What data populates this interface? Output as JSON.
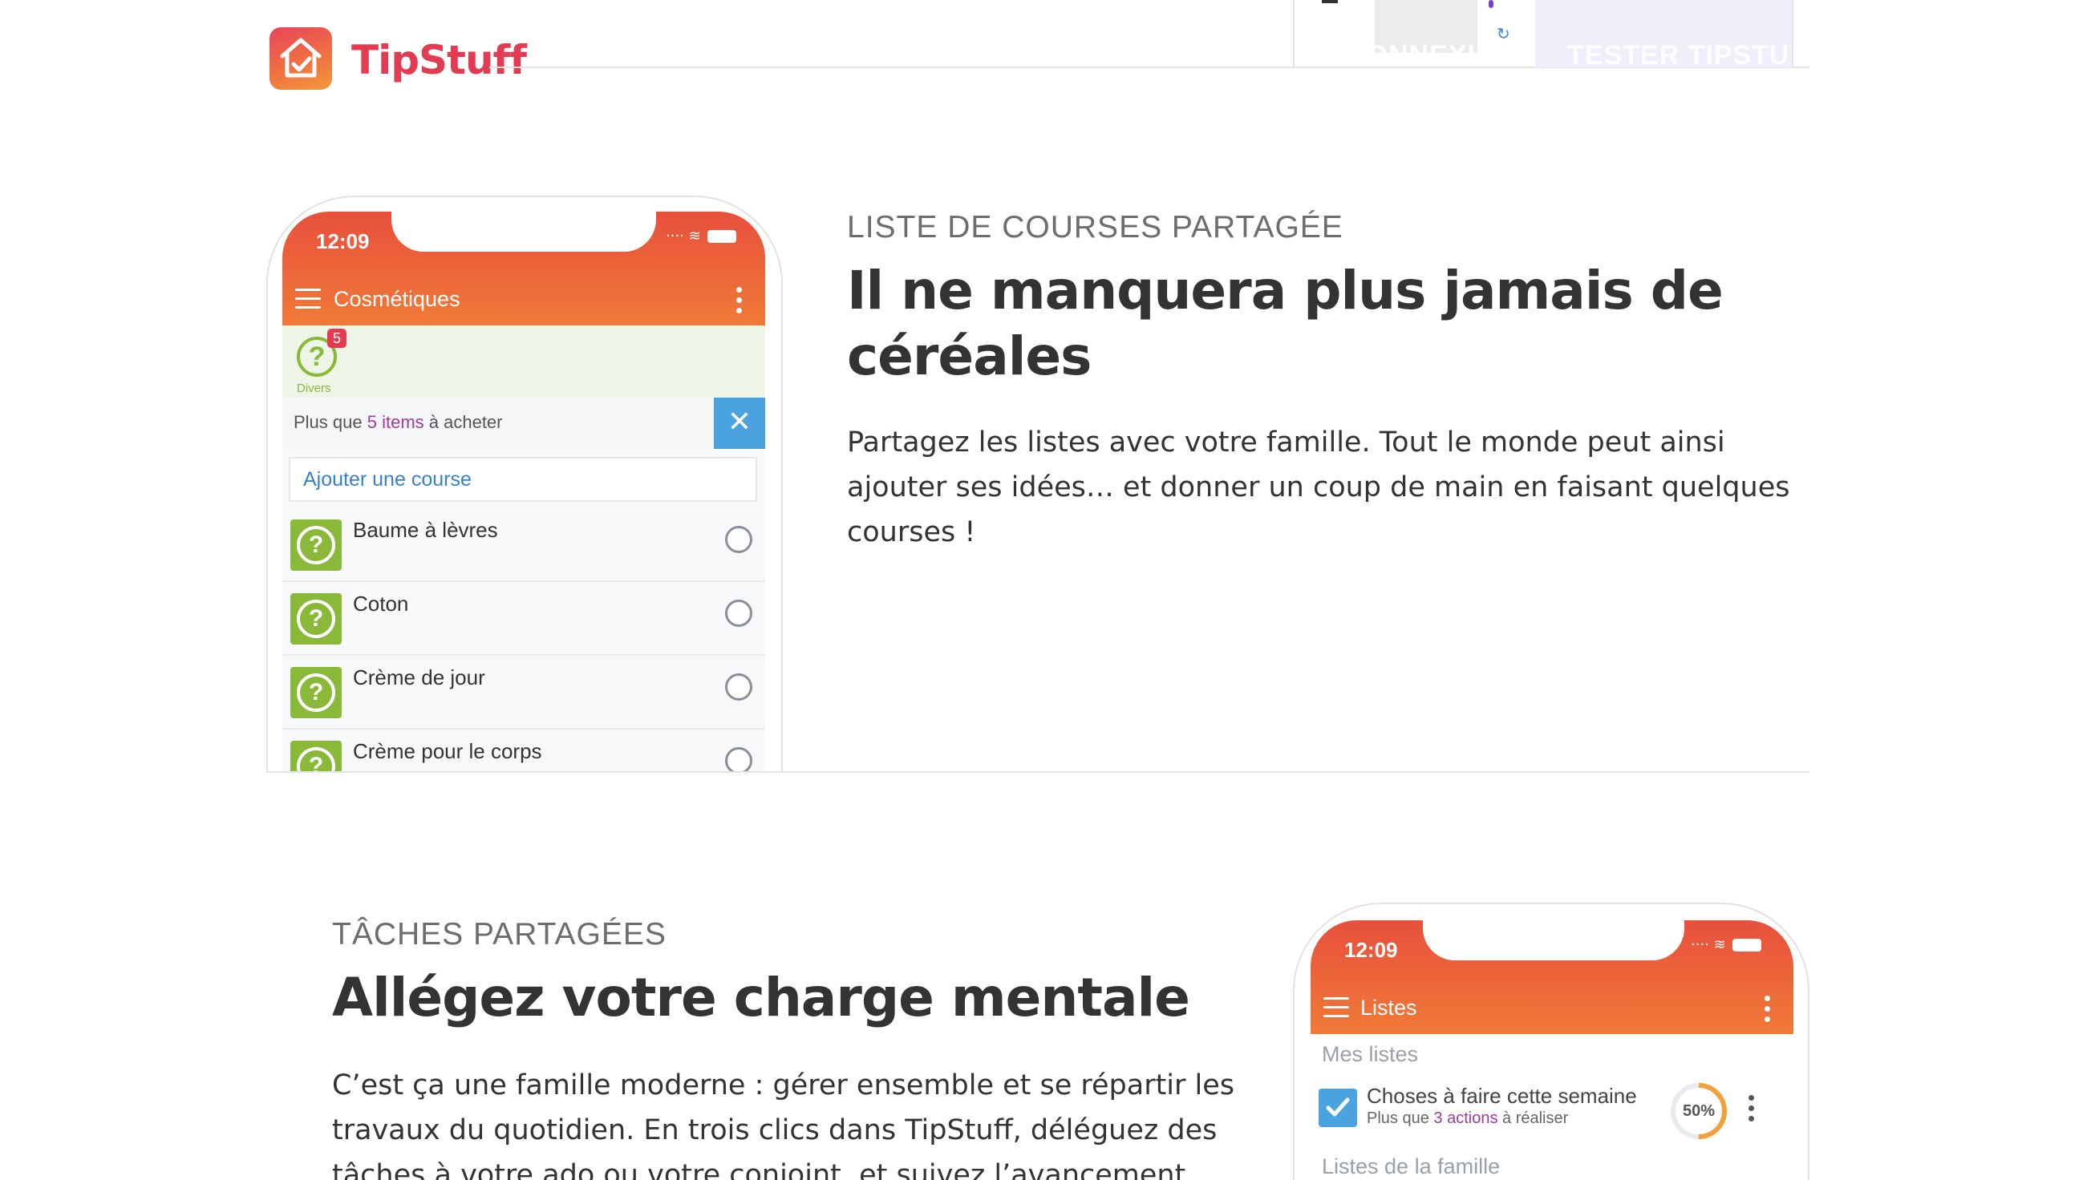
{
  "brand": {
    "name": "TipStuff",
    "color": "#e33b52"
  },
  "header": {
    "login_label": "CONNEXION",
    "try_label": "TESTER TIPSTUFF"
  },
  "section_shopping": {
    "eyebrow": "LISTE DE COURSES PARTAGÉE",
    "headline": "Il ne manquera plus jamais de céréales",
    "body": "Partagez les listes avec votre famille. Tout le monde peut ainsi ajouter ses idées… et donner un coup de main en faisant quelques courses !",
    "phone": {
      "time": "12:09",
      "screen_title": "Cosmétiques",
      "category_badge_count": "5",
      "category_badge_symbol": "?",
      "category_label": "Divers",
      "remaining_prefix": "Plus que ",
      "remaining_count": "5 items",
      "remaining_suffix": " à acheter",
      "add_placeholder": "Ajouter une course",
      "items": [
        {
          "label": "Baume à lèvres",
          "icon": "question-icon"
        },
        {
          "label": "Coton",
          "icon": "question-icon"
        },
        {
          "label": "Crème de jour",
          "icon": "question-icon"
        },
        {
          "label": "Crème pour le corps",
          "icon": "question-icon"
        }
      ]
    }
  },
  "section_tasks": {
    "eyebrow": "TÂCHES PARTAGÉES",
    "headline": "Allégez votre charge mentale",
    "body": "C’est ça une famille moderne : gérer ensemble et se répartir les travaux du quotidien. En trois clics dans TipStuff, déléguez des tâches à votre ado ou votre conjoint, et suivez l’avancement.",
    "phone": {
      "time": "12:09",
      "screen_title": "Listes",
      "my_lists_title": "Mes listes",
      "task_title": "Choses à faire cette semaine",
      "task_sub_prefix": "Plus que ",
      "task_sub_count": "3 actions",
      "task_sub_suffix": " à réaliser",
      "progress_label": "50%",
      "progress_value": 0.5,
      "family_lists_title": "Listes de la famille"
    }
  },
  "colors": {
    "accent_orange": "#f07a38",
    "accent_red": "#e8503c",
    "item_green": "#8ab93a",
    "link_blue": "#3b7fc9",
    "highlight_purple": "#a03a9c"
  }
}
